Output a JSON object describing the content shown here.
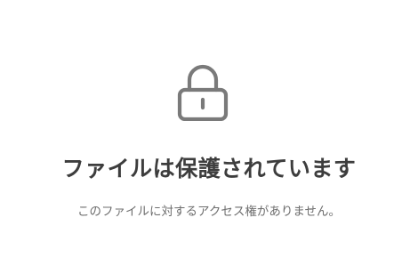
{
  "icon": "lock-icon",
  "colors": {
    "background": "#ffffff",
    "icon": "#7a7a7a",
    "title": "#3d3d3d",
    "message": "#6e6e6e"
  },
  "main": {
    "title": "ファイルは保護されています",
    "message": "このファイルに対するアクセス権がありません。"
  }
}
